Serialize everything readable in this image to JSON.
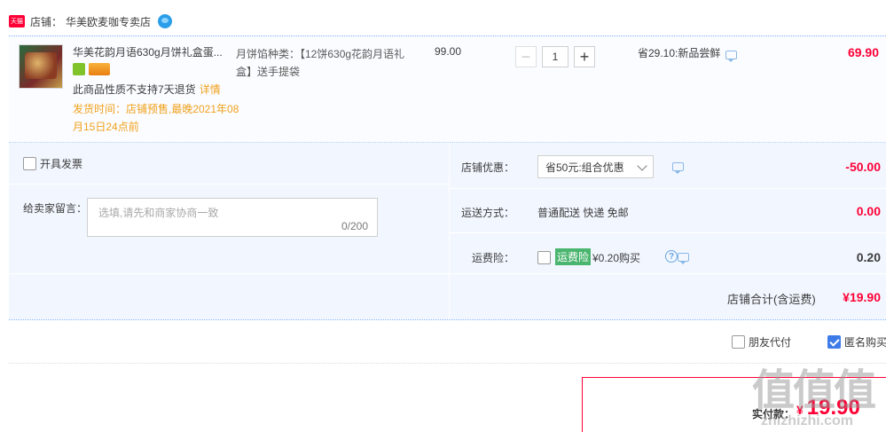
{
  "shop": {
    "badge": "天猫",
    "label": "店铺：",
    "name": "华美欧麦咖专卖店"
  },
  "item": {
    "title": "华美花韵月语630g月饼礼盒蛋...",
    "return_note": "此商品性质不支持7天退货",
    "detail_link": "详情",
    "ship_time": "发货时间：店铺预售,最晚2021年08月15日24点前",
    "sku": "月饼馅种类：【12饼630g花韵月语礼盒】送手提袋",
    "price": "99.00",
    "quantity": "1",
    "qty_minus": "−",
    "qty_plus": "+",
    "promo": "省29.10:新品尝鲜",
    "subtotal": "69.90"
  },
  "options": {
    "invoice_label": "开具发票",
    "memo_label": "给卖家留言：",
    "memo_placeholder": "选填,请先和商家协商一致",
    "memo_count": "0/200",
    "discount_label": "店铺优惠：",
    "discount_selected": "省50元:组合优惠",
    "discount_value": "-50.00",
    "shipping_label": "运送方式：",
    "shipping_value": "普通配送 快递 免邮",
    "shipping_amount": "0.00",
    "insurance_label": "运费险：",
    "insurance_tag": "运费险",
    "insurance_price": "¥0.20购买",
    "insurance_amount": "0.20",
    "help_symbol": "?",
    "total_label": "店铺合计(含运费)",
    "total_value": "¥19.90"
  },
  "footer": {
    "friend_pay": "朋友代付",
    "anonymous": "匿名购买",
    "pay_label": "实付款：",
    "pay_currency": "¥",
    "pay_value": "19.90"
  },
  "watermark": {
    "main": "值值值",
    "sub": "zhizhizhi.com"
  },
  "colors": {
    "accent": "#ff0036",
    "warning": "#f0a11c",
    "panel_bg": "#f2f7ff",
    "insurance_tag": "#4ab56e",
    "check_blue": "#3d7ce8"
  }
}
